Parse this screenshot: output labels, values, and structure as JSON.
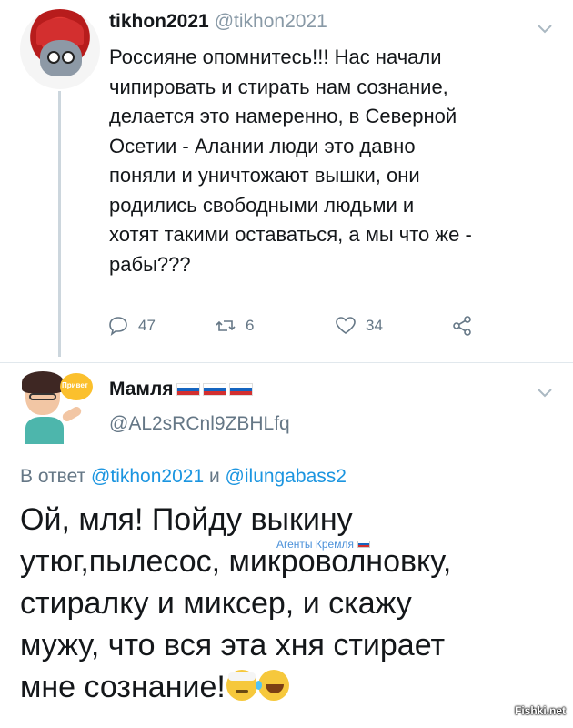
{
  "tweet1": {
    "display_name": "tikhon2021",
    "handle": "@tikhon2021",
    "text": "Россияне опомнитесь!!! Нас начали чипировать и стирать нам сознание, делается это намеренно, в Северной Осетии - Алании люди это давно поняли и уничтожают вышки, они родились свободными людьми и хотят такими оставаться, а мы что же - рабы???",
    "text_lines": [
      "Россияне опомнитесь!!! Нас начали",
      "чипировать и стирать нам сознание,",
      "делается это намеренно, в Северной",
      "Осетии - Алании люди это давно",
      "поняли и уничтожают вышки, они",
      "родились свободными людьми и",
      "хотят такими оставаться, а мы что же -",
      "рабы???"
    ],
    "replies": "47",
    "retweets": "6",
    "likes": "34",
    "icons": [
      "reply-icon",
      "retweet-icon",
      "like-icon",
      "share-icon",
      "chevron-down-icon"
    ]
  },
  "tweet2": {
    "display_name": "Мамля",
    "handle": "@AL2sRCnl9ZBHLfq",
    "avatar_bubble": "Привет",
    "reply_prefix": "В ответ",
    "reply_mention_1": "@tikhon2021",
    "reply_conjunction": "и",
    "reply_mention_2": "@ilungabass2",
    "text_lines": [
      "Ой, мля! Пойду выкину",
      "утюг,пылесос, микроволновку,",
      "стиралку и миксер, и скажу",
      "мужу, что вся эта хня стирает",
      "мне сознание!"
    ],
    "overlay_label": "Агенты Кремля"
  },
  "watermark": "Fishki.net",
  "colors": {
    "link": "#1b95e0",
    "muted": "#657786",
    "text": "#14171a"
  }
}
